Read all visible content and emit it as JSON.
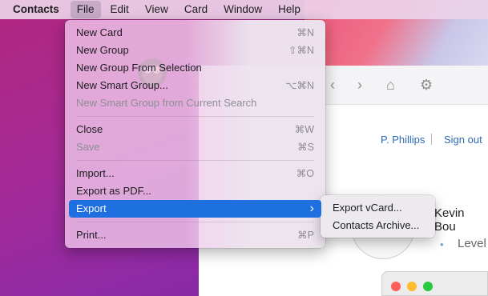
{
  "menubar": {
    "app": "Contacts",
    "items": [
      "File",
      "Edit",
      "View",
      "Card",
      "Window",
      "Help"
    ]
  },
  "file_menu": {
    "groups": [
      [
        {
          "label": "New Card",
          "shortcut": "⌘N"
        },
        {
          "label": "New Group",
          "shortcut": "⇧⌘N"
        },
        {
          "label": "New Group From Selection",
          "shortcut": ""
        },
        {
          "label": "New Smart Group...",
          "shortcut": "⌥⌘N"
        },
        {
          "label": "New Smart Group from Current Search",
          "shortcut": "",
          "disabled": true
        }
      ],
      [
        {
          "label": "Close",
          "shortcut": "⌘W"
        },
        {
          "label": "Save",
          "shortcut": "⌘S",
          "disabled": true
        }
      ],
      [
        {
          "label": "Import...",
          "shortcut": "⌘O"
        },
        {
          "label": "Export as PDF...",
          "shortcut": ""
        },
        {
          "label": "Export",
          "shortcut": "›",
          "selected": true
        }
      ],
      [
        {
          "label": "Print...",
          "shortcut": "⌘P"
        }
      ]
    ]
  },
  "export_submenu": {
    "items": [
      "Export vCard...",
      "Contacts Archive..."
    ]
  },
  "background_window": {
    "user_name": "P. Phillips",
    "sign_out": "Sign out",
    "person_name": "Kevin Bou",
    "level_label": "Level"
  },
  "colors": {
    "selection": "#1e6fe0",
    "link": "#2e6bb5",
    "traffic_red": "#fe5f57",
    "traffic_yellow": "#febc2e",
    "traffic_green": "#28c840"
  }
}
